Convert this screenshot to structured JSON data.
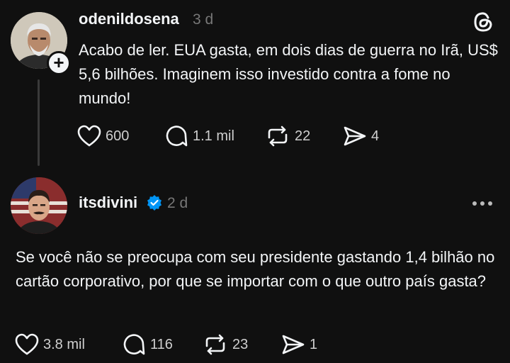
{
  "post1": {
    "username": "odenildosena",
    "time": "3 d",
    "text": "Acabo de ler. EUA gasta, em dois dias de guerra no Irã, US$ 5,6 bilhões. Imaginem isso investido contra a fome no mundo!",
    "likes": "600",
    "replies": "1.1 mil",
    "reposts": "22",
    "shares": "4"
  },
  "post2": {
    "username": "itsdivini",
    "time": "2 d",
    "text": "Se você não se preocupa com seu presidente gastando 1,4 bilhão no cartão corporativo, por que se importar com o que outro país gasta?",
    "likes": "3.8 mil",
    "replies": "116",
    "reposts": "23",
    "shares": "1"
  },
  "icons": {
    "like": "heart-icon",
    "reply": "comment-icon",
    "repost": "repost-icon",
    "share": "share-icon",
    "brand": "threads-logo-icon",
    "verified": "verified-badge-icon",
    "more": "more-options-icon"
  },
  "colors": {
    "background": "#101010",
    "verified": "#0095f6",
    "muted": "#777777"
  }
}
